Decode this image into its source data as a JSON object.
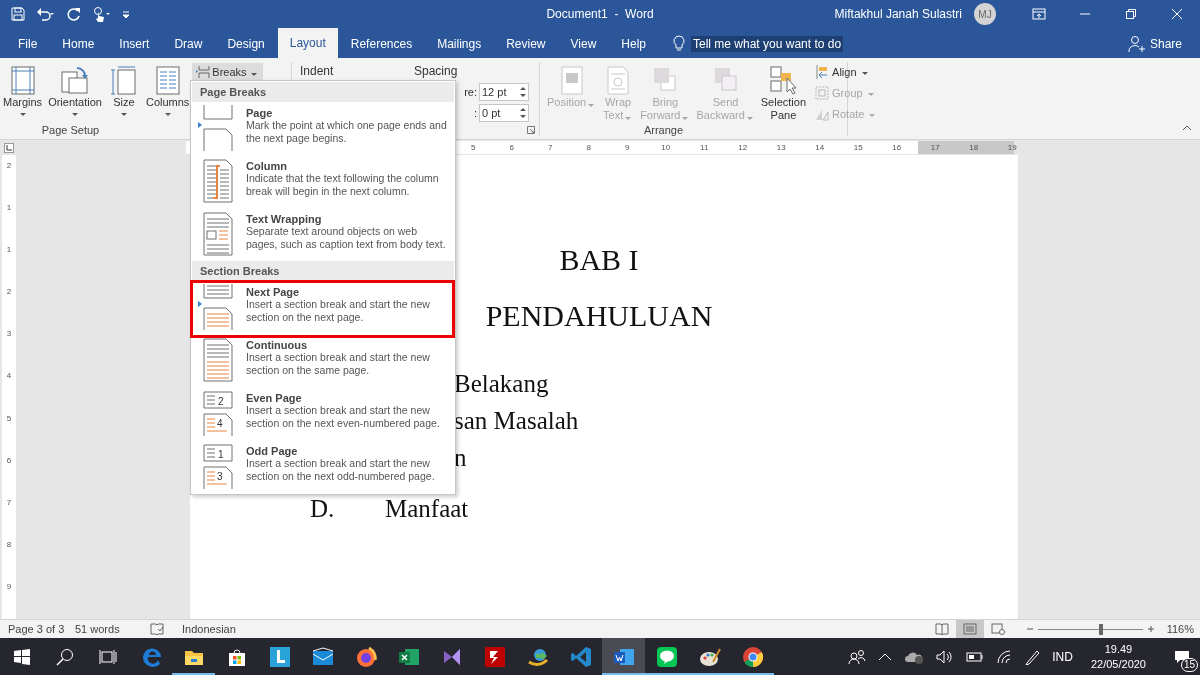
{
  "title_bar": {
    "title": "Document1  -  Word",
    "user": "Miftakhul Janah Sulastri",
    "avatar": "MJ"
  },
  "tabs": [
    {
      "label": "File",
      "selected": false
    },
    {
      "label": "Home",
      "selected": false
    },
    {
      "label": "Insert",
      "selected": false
    },
    {
      "label": "Draw",
      "selected": false
    },
    {
      "label": "Design",
      "selected": false
    },
    {
      "label": "Layout",
      "selected": true
    },
    {
      "label": "References",
      "selected": false
    },
    {
      "label": "Mailings",
      "selected": false
    },
    {
      "label": "Review",
      "selected": false
    },
    {
      "label": "View",
      "selected": false
    },
    {
      "label": "Help",
      "selected": false
    }
  ],
  "tell_me": "Tell me what you want to do",
  "share": "Share",
  "ribbon": {
    "page_setup": {
      "label": "Page Setup",
      "buttons": [
        {
          "kind": "margins",
          "label": "Margins"
        },
        {
          "kind": "orientation",
          "label": "Orientation"
        },
        {
          "kind": "size",
          "label": "Size"
        },
        {
          "kind": "columns",
          "label": "Columns"
        }
      ],
      "breaks": "Breaks"
    },
    "paragraph": {
      "indent": "Indent",
      "spacing": "Spacing",
      "fields": [
        {
          "label": "re:",
          "value": "12 pt"
        },
        {
          "label": ":",
          "value": "0 pt"
        }
      ]
    },
    "arrange": {
      "label": "Arrange",
      "buttons": [
        {
          "kind": "position",
          "lines": [
            "Position"
          ],
          "disabled": true
        },
        {
          "kind": "wrap",
          "lines": [
            "Wrap",
            "Text"
          ],
          "disabled": true
        },
        {
          "kind": "bring",
          "lines": [
            "Bring",
            "Forward"
          ],
          "disabled": true
        },
        {
          "kind": "send",
          "lines": [
            "Send",
            "Backward"
          ],
          "disabled": true
        },
        {
          "kind": "selection",
          "lines": [
            "Selection",
            "Pane"
          ],
          "disabled": false
        }
      ],
      "small": [
        {
          "kind": "align",
          "label": "Align",
          "disabled": false
        },
        {
          "kind": "group",
          "label": "Group",
          "disabled": true
        },
        {
          "kind": "rotate",
          "label": "Rotate",
          "disabled": true
        }
      ]
    }
  },
  "ruler": {
    "marks": [
      "5",
      "6",
      "7",
      "8",
      "9",
      "10",
      "11",
      "12",
      "13",
      "14",
      "15",
      "16",
      "17",
      "18",
      "19"
    ]
  },
  "vertical_ruler": {
    "marks": [
      "2",
      "1",
      "1",
      "2",
      "3",
      "4",
      "5",
      "6",
      "7",
      "8",
      "9"
    ]
  },
  "breaks_menu": {
    "sections": [
      {
        "title": "Page Breaks",
        "items": [
          {
            "kind": "page",
            "title": "Page",
            "description": "Mark the point at which one page ends and the next page begins.",
            "highlighted": false
          },
          {
            "kind": "column",
            "title": "Column",
            "description": "Indicate that the text following the column break will begin in the next column.",
            "highlighted": false
          },
          {
            "kind": "wrapping",
            "title": "Text Wrapping",
            "description": "Separate text around objects on web pages, such as caption text from body text.",
            "highlighted": false
          }
        ]
      },
      {
        "title": "Section Breaks",
        "items": [
          {
            "kind": "next",
            "title": "Next Page",
            "description": "Insert a section break and start the new section on the next page.",
            "highlighted": true
          },
          {
            "kind": "continuous",
            "title": "Continuous",
            "description": "Insert a section break and start the new section on the same page.",
            "highlighted": false
          },
          {
            "kind": "even",
            "title": "Even Page",
            "description": "Insert a section break and start the new section on the next even-numbered page.",
            "highlighted": false,
            "icon_labels": [
              "2",
              "4"
            ]
          },
          {
            "kind": "odd",
            "title": "Odd Page",
            "description": "Insert a section break and start the new section on the next odd-numbered page.",
            "highlighted": false,
            "icon_labels": [
              "1",
              "3"
            ]
          }
        ]
      }
    ]
  },
  "document": {
    "headings": [
      "BAB I",
      "PENDAHULUAN"
    ],
    "lines": [
      {
        "kind": "partial",
        "text": "Belakang"
      },
      {
        "kind": "partial",
        "text": "san Masalah"
      },
      {
        "kind": "partial",
        "text": "n"
      },
      {
        "kind": "item",
        "marker": "D.",
        "text": "Manfaat"
      }
    ]
  },
  "status_bar": {
    "page": "Page 3 of 3",
    "words": "51 words",
    "language": "Indonesian",
    "views": [
      {
        "kind": "read",
        "selected": false
      },
      {
        "kind": "print",
        "selected": true
      },
      {
        "kind": "web",
        "selected": false
      }
    ],
    "zoom_slider": {
      "level": 0.6
    },
    "zoom": "116%"
  },
  "taskbar": {
    "apps": [
      {
        "kind": "edge",
        "running": false,
        "selected": false
      },
      {
        "kind": "explorer",
        "running": true,
        "selected": false
      },
      {
        "kind": "store",
        "running": false,
        "selected": false
      },
      {
        "kind": "lapp",
        "running": false,
        "selected": false
      },
      {
        "kind": "mail",
        "running": false,
        "selected": false
      },
      {
        "kind": "firefox",
        "running": false,
        "selected": false
      },
      {
        "kind": "excel",
        "running": false,
        "selected": false
      },
      {
        "kind": "vs",
        "running": false,
        "selected": false
      },
      {
        "kind": "filezilla",
        "running": false,
        "selected": false
      },
      {
        "kind": "idm",
        "running": false,
        "selected": false
      },
      {
        "kind": "vscode",
        "running": false,
        "selected": false
      },
      {
        "kind": "word",
        "running": true,
        "selected": true
      },
      {
        "kind": "line",
        "running": true,
        "selected": false
      },
      {
        "kind": "paint",
        "running": true,
        "selected": false
      },
      {
        "kind": "chrome",
        "running": true,
        "selected": false
      }
    ],
    "language": "IND",
    "time": "19.49",
    "date": "22/05/2020",
    "notifications": "15"
  }
}
